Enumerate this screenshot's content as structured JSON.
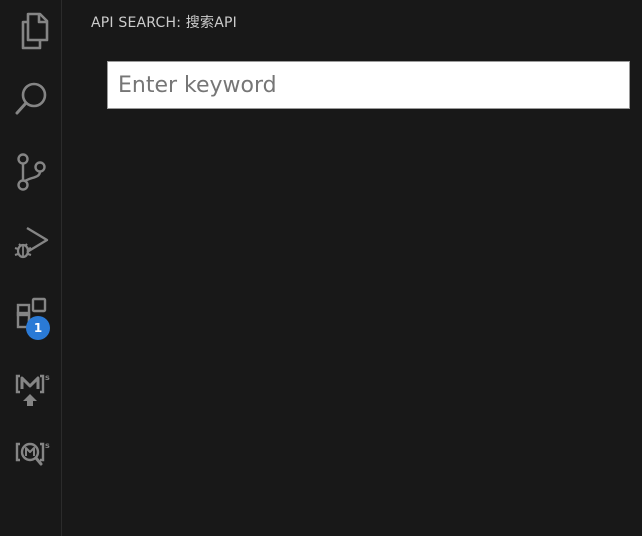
{
  "activity_bar": {
    "items": [
      {
        "icon": "files-icon"
      },
      {
        "icon": "search-icon"
      },
      {
        "icon": "source-control-icon"
      },
      {
        "icon": "run-debug-icon"
      },
      {
        "icon": "extensions-icon",
        "badge": "1"
      },
      {
        "icon": "m-upload-icon"
      },
      {
        "icon": "m-search-icon"
      }
    ],
    "badge_color": "#2a7ad6"
  },
  "sidebar": {
    "title": "API SEARCH: 搜索API",
    "search": {
      "placeholder": "Enter keyword",
      "value": ""
    }
  },
  "colors": {
    "background": "#181818",
    "icon": "#858585",
    "title_text": "#cccccc"
  }
}
